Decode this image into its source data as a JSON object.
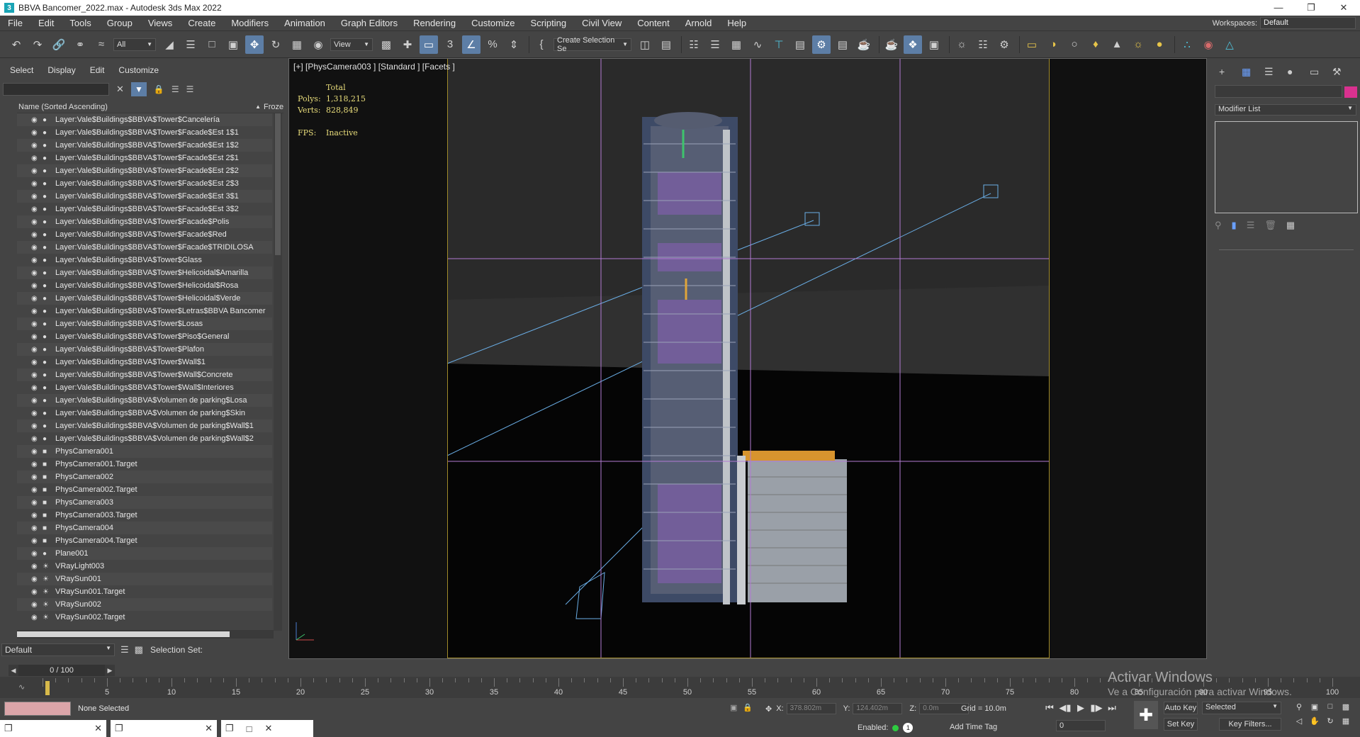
{
  "title_bar": {
    "app_icon": "3",
    "title": "BBVA Bancomer_2022.max - Autodesk 3ds Max 2022"
  },
  "menu": {
    "items": [
      "File",
      "Edit",
      "Tools",
      "Group",
      "Views",
      "Create",
      "Modifiers",
      "Animation",
      "Graph Editors",
      "Rendering",
      "Customize",
      "Scripting",
      "Civil View",
      "Content",
      "Arnold",
      "Help"
    ],
    "workspace_label": "Workspaces:",
    "workspace_value": "Default"
  },
  "toolbar": {
    "selection_filter": "All",
    "ref_coord": "View",
    "create_selection_set": "Create Selection Se"
  },
  "explorer": {
    "tabs": [
      "Select",
      "Display",
      "Edit",
      "Customize"
    ],
    "col_name": "Name (Sorted Ascending)",
    "col_froze": "Froze",
    "rows": [
      "Layer:Vale$Buildings$BBVA$Tower$Cancelería",
      "Layer:Vale$Buildings$BBVA$Tower$Facade$Est 1$1",
      "Layer:Vale$Buildings$BBVA$Tower$Facade$Est 1$2",
      "Layer:Vale$Buildings$BBVA$Tower$Facade$Est 2$1",
      "Layer:Vale$Buildings$BBVA$Tower$Facade$Est 2$2",
      "Layer:Vale$Buildings$BBVA$Tower$Facade$Est 2$3",
      "Layer:Vale$Buildings$BBVA$Tower$Facade$Est 3$1",
      "Layer:Vale$Buildings$BBVA$Tower$Facade$Est 3$2",
      "Layer:Vale$Buildings$BBVA$Tower$Facade$Polis",
      "Layer:Vale$Buildings$BBVA$Tower$Facade$Red",
      "Layer:Vale$Buildings$BBVA$Tower$Facade$TRIDILOSA",
      "Layer:Vale$Buildings$BBVA$Tower$Glass",
      "Layer:Vale$Buildings$BBVA$Tower$Helicoidal$Amarilla",
      "Layer:Vale$Buildings$BBVA$Tower$Helicoidal$Rosa",
      "Layer:Vale$Buildings$BBVA$Tower$Helicoidal$Verde",
      "Layer:Vale$Buildings$BBVA$Tower$Letras$BBVA Bancomer",
      "Layer:Vale$Buildings$BBVA$Tower$Losas",
      "Layer:Vale$Buildings$BBVA$Tower$Piso$General",
      "Layer:Vale$Buildings$BBVA$Tower$Plafon",
      "Layer:Vale$Buildings$BBVA$Tower$Wall$1",
      "Layer:Vale$Buildings$BBVA$Tower$Wall$Concrete",
      "Layer:Vale$Buildings$BBVA$Tower$Wall$Interiores",
      "Layer:Vale$Buildings$BBVA$Volumen de parking$Losa",
      "Layer:Vale$Buildings$BBVA$Volumen de parking$Skin",
      "Layer:Vale$Buildings$BBVA$Volumen de parking$Wall$1",
      "Layer:Vale$Buildings$BBVA$Volumen de parking$Wall$2",
      "PhysCamera001",
      "PhysCamera001.Target",
      "PhysCamera002",
      "PhysCamera002.Target",
      "PhysCamera003",
      "PhysCamera003.Target",
      "PhysCamera004",
      "PhysCamera004.Target",
      "Plane001",
      "VRayLight003",
      "VRaySun001",
      "VRaySun001.Target",
      "VRaySun002",
      "VRaySun002.Target"
    ],
    "layer": "Default",
    "selection_set_label": "Selection Set:"
  },
  "frame_slider": "0 / 100",
  "timeline": {
    "ticks": [
      "5",
      "10",
      "15",
      "20",
      "25",
      "30",
      "35",
      "40",
      "45",
      "50",
      "55",
      "60",
      "65",
      "70",
      "75",
      "80",
      "85",
      "90",
      "95",
      "100"
    ]
  },
  "viewport": {
    "label": "[+] [PhysCamera003 ] [Standard ] [Facets ]",
    "stats_header": "Total",
    "polys_label": "Polys:",
    "polys": "1,318,215",
    "verts_label": "Verts:",
    "verts": "828,849",
    "fps_label": "FPS:",
    "fps": "Inactive"
  },
  "command_panel": {
    "modifier_list": "Modifier List",
    "object_color": "#d9318f"
  },
  "status": {
    "selection": "None Selected",
    "x_label": "X:",
    "x_value": "378.802m",
    "y_label": "Y:",
    "y_value": "124.402m",
    "z_label": "Z:",
    "z_value": "0.0m",
    "grid": "Grid = 10.0m",
    "enabled_label": "Enabled:",
    "enabled_count": "1",
    "add_time_tag": "Add Time Tag",
    "auto_key": "Auto Key",
    "set_key": "Set Key",
    "selected_dd": "Selected",
    "key_filters": "Key Filters...",
    "frame_field": "0"
  },
  "watermark": {
    "line1": "Activar Windows",
    "line2": "Ve a Configuración para activar Windows."
  }
}
